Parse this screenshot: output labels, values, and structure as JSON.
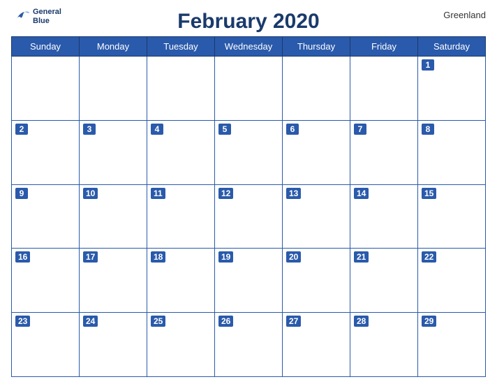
{
  "header": {
    "title": "February 2020",
    "region": "Greenland",
    "logo_line1": "General",
    "logo_line2": "Blue"
  },
  "weekdays": [
    "Sunday",
    "Monday",
    "Tuesday",
    "Wednesday",
    "Thursday",
    "Friday",
    "Saturday"
  ],
  "weeks": [
    [
      null,
      null,
      null,
      null,
      null,
      null,
      1
    ],
    [
      2,
      3,
      4,
      5,
      6,
      7,
      8
    ],
    [
      9,
      10,
      11,
      12,
      13,
      14,
      15
    ],
    [
      16,
      17,
      18,
      19,
      20,
      21,
      22
    ],
    [
      23,
      24,
      25,
      26,
      27,
      28,
      29
    ]
  ]
}
